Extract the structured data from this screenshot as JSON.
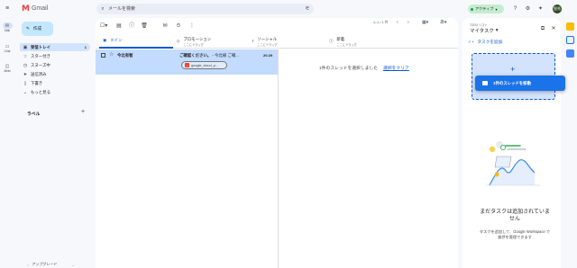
{
  "app": {
    "logo_text": "Gmail"
  },
  "rail": [
    {
      "label": "Mail",
      "icon": "mail-icon"
    },
    {
      "label": "Chat",
      "icon": "chat-icon"
    },
    {
      "label": "Meet",
      "icon": "meet-icon"
    }
  ],
  "search": {
    "placeholder": "メールを検索"
  },
  "status": {
    "label": "アクティブ",
    "color": "#0f9d58"
  },
  "avatar": {
    "initials": "智秀"
  },
  "compose": {
    "label": "作成"
  },
  "nav": [
    {
      "label": "受信トレイ",
      "count": "1",
      "icon": "inbox-icon",
      "selected": true
    },
    {
      "label": "スター付き",
      "count": "",
      "icon": "star-icon"
    },
    {
      "label": "スヌーズ中",
      "count": "",
      "icon": "clock-icon"
    },
    {
      "label": "送信済み",
      "count": "",
      "icon": "send-icon"
    },
    {
      "label": "下書き",
      "count": "",
      "icon": "draft-icon"
    },
    {
      "label": "もっと見る",
      "count": "",
      "icon": "chevron-down-icon"
    }
  ],
  "labels": {
    "title": "ラベル"
  },
  "upgrade": {
    "label": "アップグレード"
  },
  "pager": {
    "text": "1–1 / 1 件"
  },
  "tabs": [
    {
      "label": "メイン",
      "sub": "",
      "icon": "inbox-icon",
      "selected": true
    },
    {
      "label": "プロモーション",
      "sub": "ここにドラッグ",
      "icon": "tag-icon"
    },
    {
      "label": "ソーシャル",
      "sub": "ここにドラッグ",
      "icon": "people-icon"
    },
    {
      "label": "新着",
      "sub": "ここにドラッグ",
      "icon": "info-icon"
    }
  ],
  "email": {
    "sender": "今北有智",
    "subject_bold": "ご確認ください。",
    "snippet": " - 今北様 ご確...",
    "time": "20:29",
    "attachment": "google_cloud_p..."
  },
  "reading_pane": {
    "empty_text": "1件のスレッドを選択しました",
    "clear_link": "選択をクリア"
  },
  "tasks": {
    "app_label": "TODO リスト",
    "title": "マイタスク",
    "add_label": "タスクを追加",
    "drag_label": "1件のスレッドを移動",
    "empty_title": "まだタスクは追加されていません",
    "empty_sub": "タスクを追加して、Google Workspace で進捗を管理できます"
  },
  "colors": {
    "accent": "#0b57d0",
    "selected_row": "#c2dbff",
    "compose": "#c2e7ff"
  }
}
